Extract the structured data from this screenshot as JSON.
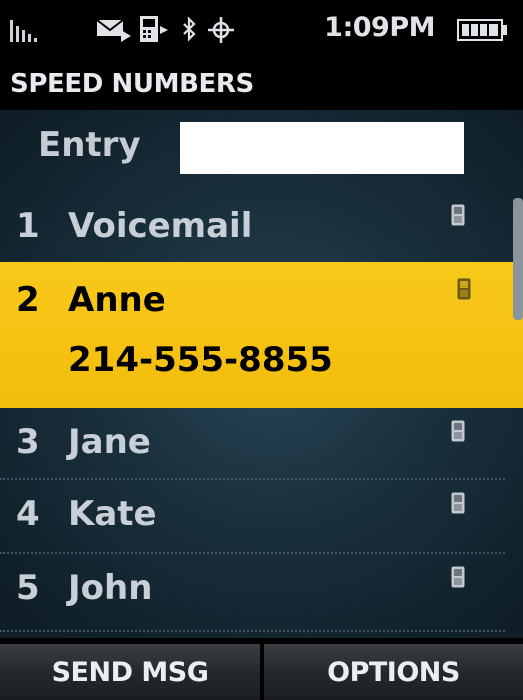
{
  "status_bar": {
    "time": "1:09PM",
    "icons": [
      "signal-strength-icon",
      "message-icon",
      "voicemail-icon",
      "bluetooth-icon",
      "gps-icon",
      "battery-icon"
    ]
  },
  "screen": {
    "title": "SPEED NUMBERS"
  },
  "entry": {
    "label": "Entry",
    "value": ""
  },
  "speed_list": [
    {
      "number": "1",
      "name": "Voicemail",
      "device_icon": "mobile-phone-icon"
    },
    {
      "number": "2",
      "name": "Anne",
      "phone": "214-555-8855",
      "device_icon": "mobile-phone-icon",
      "selected": true
    },
    {
      "number": "3",
      "name": "Jane",
      "device_icon": "mobile-phone-icon"
    },
    {
      "number": "4",
      "name": "Kate",
      "device_icon": "mobile-phone-icon"
    },
    {
      "number": "5",
      "name": "John",
      "device_icon": "mobile-phone-icon"
    }
  ],
  "softkeys": {
    "left": "SEND MSG",
    "right": "OPTIONS"
  },
  "colors": {
    "highlight": "#f3bd0d",
    "background": "#1a303d"
  }
}
